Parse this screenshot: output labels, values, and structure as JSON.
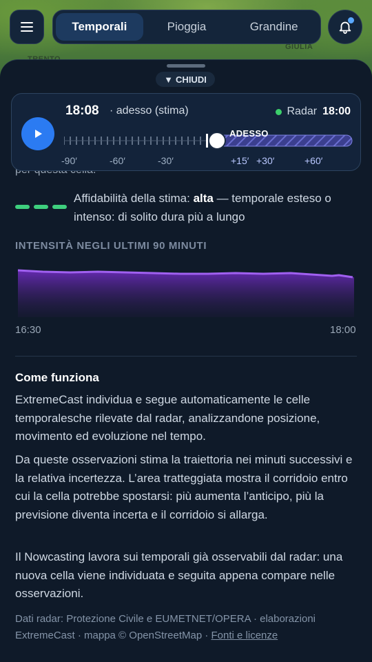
{
  "map": {
    "labels": [
      "TRENTO",
      "GIULIA"
    ]
  },
  "topbar": {
    "tabs": [
      {
        "label": "Temporali",
        "active": true
      },
      {
        "label": "Pioggia",
        "active": false
      },
      {
        "label": "Grandine",
        "active": false
      }
    ]
  },
  "sheet": {
    "close_label": "CHIUDI",
    "timeline": {
      "time": "18:08",
      "time_note": "· adesso (stima)",
      "radar_label": "Radar",
      "radar_time": "18:00",
      "now_marker": "ADESSO",
      "ticks_past": [
        "-90′",
        "-60′",
        "-30′"
      ],
      "ticks_future": [
        "+15′",
        "+30′",
        "+60′"
      ],
      "progress_fraction": 0.52
    },
    "peek_text": "per questa cella.",
    "reliability": {
      "level_bars": 3,
      "prefix": "Affidabilità della stima: ",
      "value": "alta",
      "suffix": " — temporale esteso o intenso: di solito dura più a lungo"
    },
    "intensity": {
      "title": "INTENSITÀ NEGLI ULTIMI 90 MINUTI",
      "start_label": "16:30",
      "end_label": "18:00"
    },
    "how": {
      "title": "Come funziona",
      "p1": "ExtremeCast individua e segue automaticamente le celle temporalesche rilevate dal radar, analizzandone posizione, movimento ed evoluzione nel tempo.",
      "p2": "Da queste osservazioni stima la traiettoria nei minuti successivi e la relativa incertezza. L’area tratteggiata mostra il corridoio entro cui la cella potrebbe spostarsi: più aumenta l’anticipo, più la previsione diventa incerta e il corridoio si allarga.",
      "p3": "Il Nowcasting lavora sui temporali già osservabili dal radar: una nuova cella viene individuata e seguita appena compare nelle osservazioni."
    },
    "footer": {
      "text": "Dati radar: Protezione Civile e EUMETNET/OPERA · elaborazioni ExtremeCast · mappa © OpenStreetMap · ",
      "link": "Fonti e licenze"
    }
  },
  "colors": {
    "accent": "#2b7bf2",
    "reliability": "#3ecf7e",
    "intensity": "#8b3fe0",
    "radar_ok": "#3ccf6b"
  }
}
